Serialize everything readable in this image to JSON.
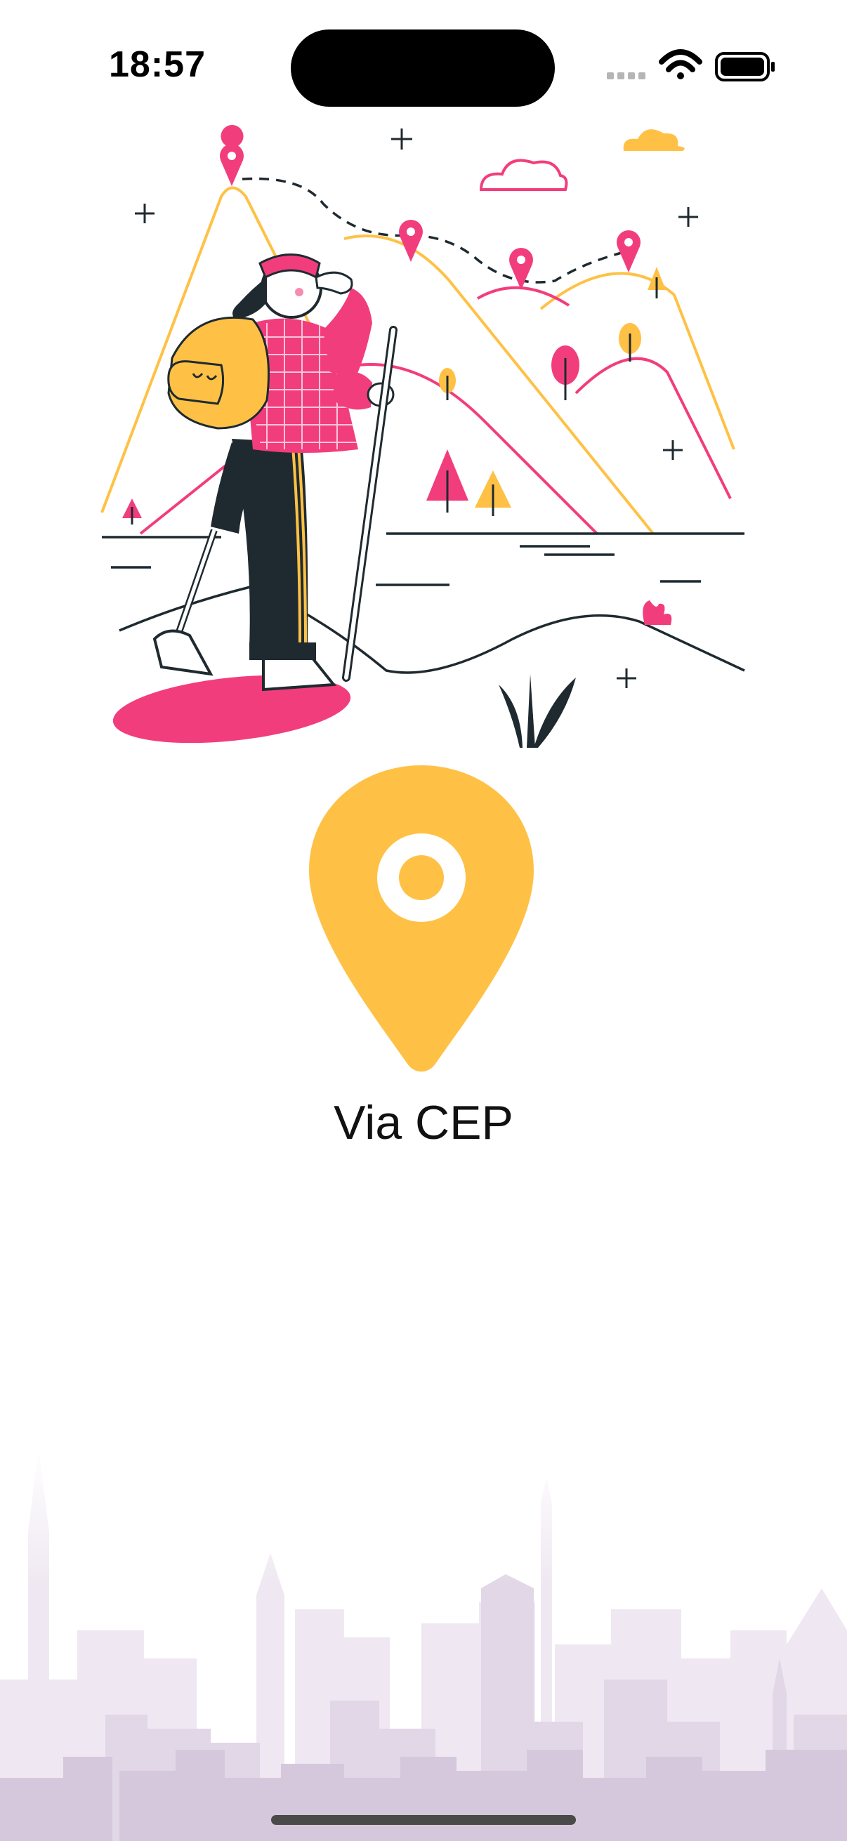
{
  "status_bar": {
    "time": "18:57",
    "icons": [
      "signal-dots-icon",
      "wifi-icon",
      "battery-icon"
    ]
  },
  "illustration": {
    "name": "hiker-with-map-pins-illustration",
    "colors": {
      "pink": "#F23D7D",
      "yellow": "#FFC145",
      "dark": "#1F2A30"
    }
  },
  "logo": {
    "icon": "location-pin-icon",
    "color": "#FFC145"
  },
  "app": {
    "title": "Via CEP"
  },
  "background": {
    "skyline_color": "#D9CCE0"
  }
}
